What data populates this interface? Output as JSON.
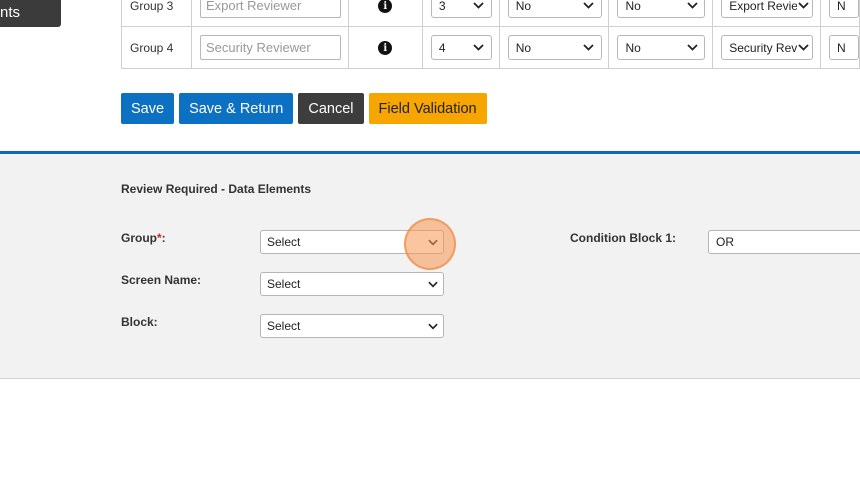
{
  "side_tab": {
    "label": "nts"
  },
  "table": {
    "rows": [
      {
        "group": "Group 3",
        "name_value": "Export Reviewer",
        "order": "3",
        "flag1": "No",
        "flag2": "No",
        "reviewer": "Export Reviewer",
        "extra": "N"
      },
      {
        "group": "Group 4",
        "name_value": "Security Reviewer",
        "order": "4",
        "flag1": "No",
        "flag2": "No",
        "reviewer": "Security Reviewer",
        "extra": "N"
      }
    ]
  },
  "buttons": {
    "save": "Save",
    "save_return": "Save & Return",
    "cancel": "Cancel",
    "field_validation": "Field Validation"
  },
  "review": {
    "title": "Review Required - Data Elements",
    "group_label": "Group",
    "required_mark": "*",
    "group_colon": ":",
    "group_value": "Select",
    "screen_name_label": "Screen Name:",
    "screen_name_value": "Select",
    "block_label": "Block:",
    "block_value": "Select",
    "condition_label": "Condition Block 1:",
    "condition_value": "OR"
  },
  "colors": {
    "primary": "#0c70c3",
    "dark": "#3d3d3d",
    "warning": "#f7a600",
    "divider": "#0c6ab8"
  }
}
